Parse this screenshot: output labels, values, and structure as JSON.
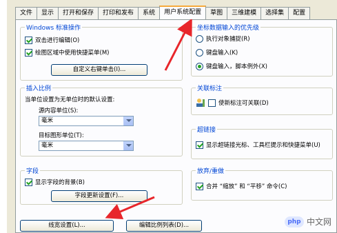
{
  "tabs": [
    "文件",
    "显示",
    "打开和保存",
    "打印和发布",
    "系统",
    "用户系统配置",
    "草图",
    "三维建模",
    "选择集",
    "配置"
  ],
  "active_tab": "用户系统配置",
  "windows_group": {
    "title": "Windows 标准操作",
    "cb1": "双击进行编辑(O)",
    "cb2": "绘图区域中使用快捷菜单(M)",
    "btn": "自定义右键单击(I)..."
  },
  "insert_group": {
    "title": "插入比例",
    "desc": "当单位设置为无单位时的默认设置:",
    "source_label": "源内容单位(S):",
    "source_value": "毫米",
    "target_label": "目标图形单位(T):",
    "target_value": "毫米"
  },
  "field_group": {
    "title": "字段",
    "cb": "显示字段的背景(B)",
    "btn": "字段更新设置(F)..."
  },
  "coord_group": {
    "title": "坐标数据输入的优先级",
    "r1": "执行对象捕捉(R)",
    "r2": "键盘输入(K)",
    "r3": "键盘输入，脚本例外(X)"
  },
  "assoc_group": {
    "title": "关联标注",
    "cb": "使新标注可关联(D)"
  },
  "link_group": {
    "title": "超链接",
    "cb": "显示超链接光标、工具栏提示和快捷菜单(U)"
  },
  "undo_group": {
    "title": "放弃/重做",
    "cb": "合并 “缩放” 和 “平移” 命令(C)"
  },
  "bottom": {
    "lineweight_btn": "线宽设置(L)...",
    "scale_btn": "编辑比例列表(D)..."
  },
  "watermark": {
    "logo": "php",
    "text": "中文网"
  }
}
